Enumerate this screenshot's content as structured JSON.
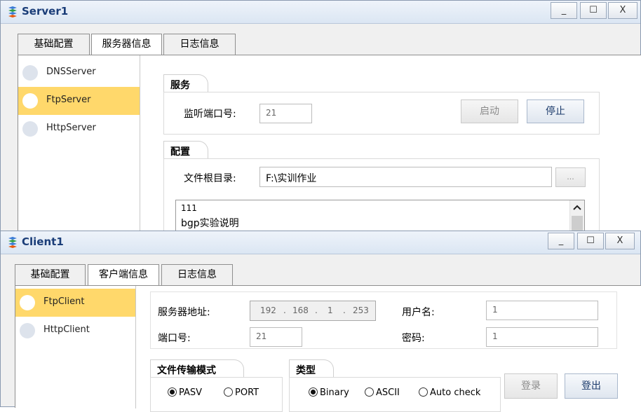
{
  "server": {
    "title": "Server1",
    "window_buttons": {
      "minimize": "_",
      "maximize": "☐",
      "close": "X"
    },
    "tabs": [
      "基础配置",
      "服务器信息",
      "日志信息"
    ],
    "active_tab": 1,
    "services": [
      {
        "label": "DNSServer"
      },
      {
        "label": "FtpServer",
        "selected": true
      },
      {
        "label": "HttpServer"
      }
    ],
    "service_group": {
      "title": "服务",
      "port_label": "监听端口号:",
      "port_value": "21",
      "start_label": "启动",
      "stop_label": "停止"
    },
    "config_group": {
      "title": "配置",
      "root_label": "文件根目录:",
      "root_value": "F:\\实训作业",
      "browse_label": "...",
      "files": [
        "111",
        "bgp实验说明"
      ]
    }
  },
  "client": {
    "title": "Client1",
    "window_buttons": {
      "minimize": "_",
      "maximize": "☐",
      "close": "X"
    },
    "tabs": [
      "基础配置",
      "客户端信息",
      "日志信息"
    ],
    "active_tab": 1,
    "clients": [
      {
        "label": "FtpClient",
        "selected": true
      },
      {
        "label": "HttpClient"
      }
    ],
    "server_addr_label": "服务器地址:",
    "ip_parts": [
      "192",
      "168",
      "1",
      "253"
    ],
    "port_label": "端口号:",
    "port_value": "21",
    "username_label": "用户名:",
    "username_value": "1",
    "password_label": "密码:",
    "password_value": "1",
    "transfer_mode": {
      "title": "文件传输模式",
      "options": [
        "PASV",
        "PORT"
      ],
      "selected": "PASV"
    },
    "type": {
      "title": "类型",
      "options": [
        "Binary",
        "ASCII",
        "Auto check"
      ],
      "selected": "Binary"
    },
    "login_label": "登录",
    "logout_label": "登出"
  },
  "colors": {
    "selected_item": "#ffd86b",
    "title_text": "#1a3d78"
  }
}
